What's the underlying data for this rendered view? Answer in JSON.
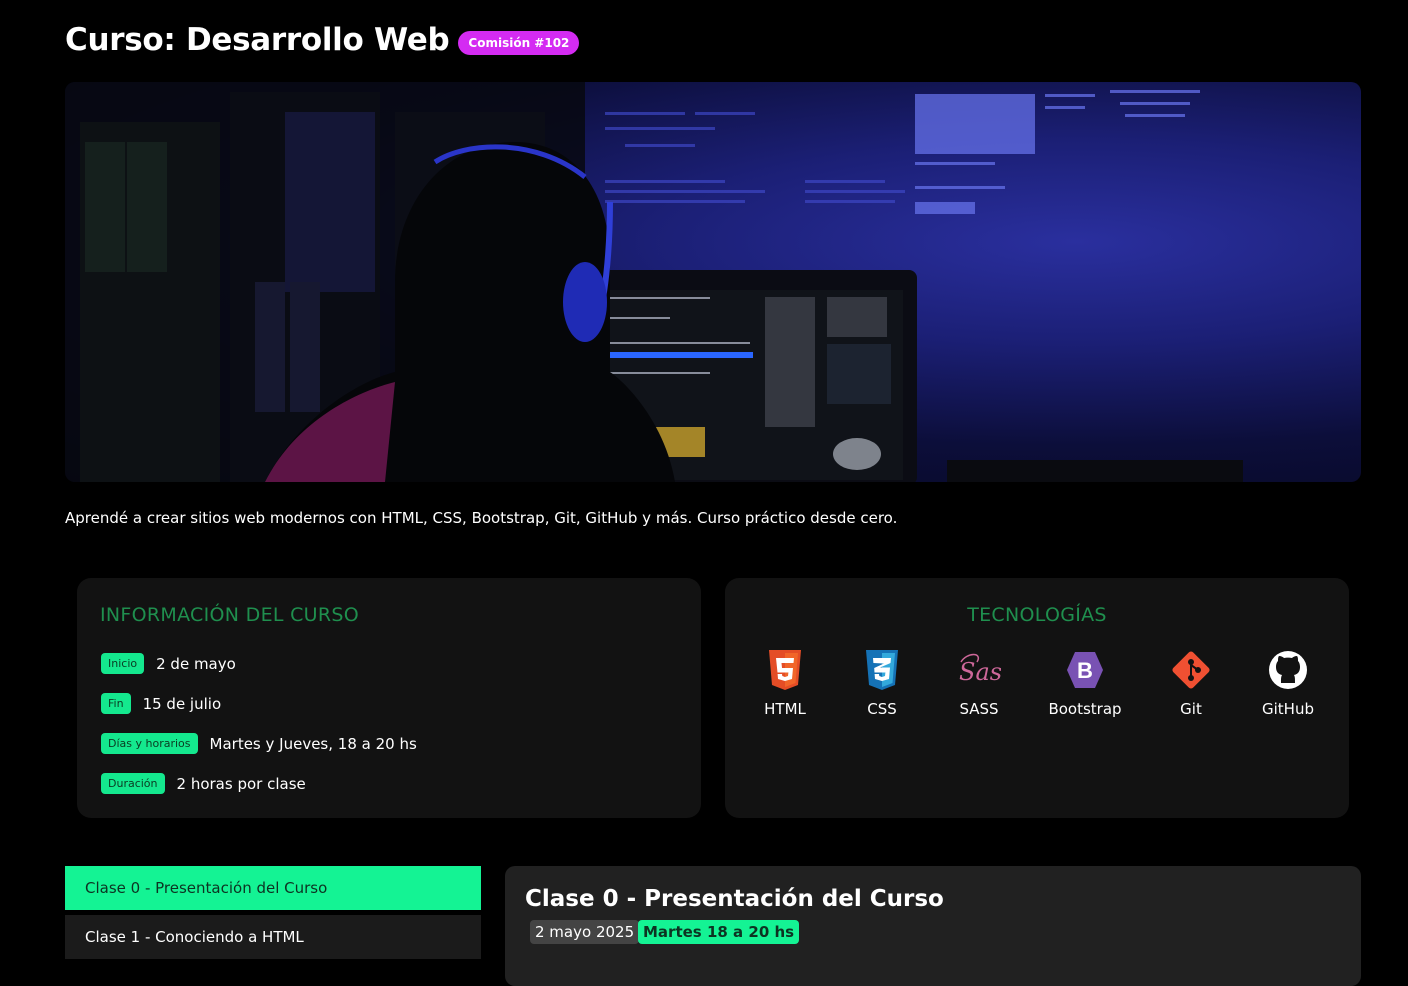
{
  "header": {
    "title": "Curso: Desarrollo Web",
    "badge": "Comisión #102"
  },
  "intro": "Aprendé a crear sitios web modernos con HTML, CSS, Bootstrap, Git, GitHub y más. Curso práctico desde cero.",
  "info": {
    "title": "INFORMACIÓN DEL CURSO",
    "rows": [
      {
        "label": "Inicio",
        "value": "2 de mayo"
      },
      {
        "label": "Fin",
        "value": "15 de julio"
      },
      {
        "label": "Días y horarios",
        "value": "Martes y Jueves, 18 a 20 hs"
      },
      {
        "label": "Duración",
        "value": "2 horas por clase"
      }
    ]
  },
  "tech": {
    "title": "TECNOLOGÍAS",
    "items": [
      {
        "label": "HTML",
        "icon": "html5-icon",
        "color": "#e44d26"
      },
      {
        "label": "CSS",
        "icon": "css3-icon",
        "color": "#1572b6"
      },
      {
        "label": "SASS",
        "icon": "sass-icon",
        "color": "#cd6799"
      },
      {
        "label": "Bootstrap",
        "icon": "bootstrap-icon",
        "color": "#7952b3"
      },
      {
        "label": "Git",
        "icon": "git-icon",
        "color": "#f05032"
      },
      {
        "label": "GitHub",
        "icon": "github-icon",
        "color": "#ffffff"
      }
    ]
  },
  "classes": [
    {
      "label": "Clase 0 - Presentación del Curso"
    },
    {
      "label": "Clase 1 - Conociendo a HTML"
    }
  ],
  "detail": {
    "title": "Clase 0 - Presentación del Curso",
    "date": "2 mayo 2025",
    "time": "Martes 18 a 20 hs"
  },
  "colors": {
    "accent_green": "#14f394",
    "badge_purple": "#d42bf2",
    "section_title": "#1f8f4e"
  }
}
